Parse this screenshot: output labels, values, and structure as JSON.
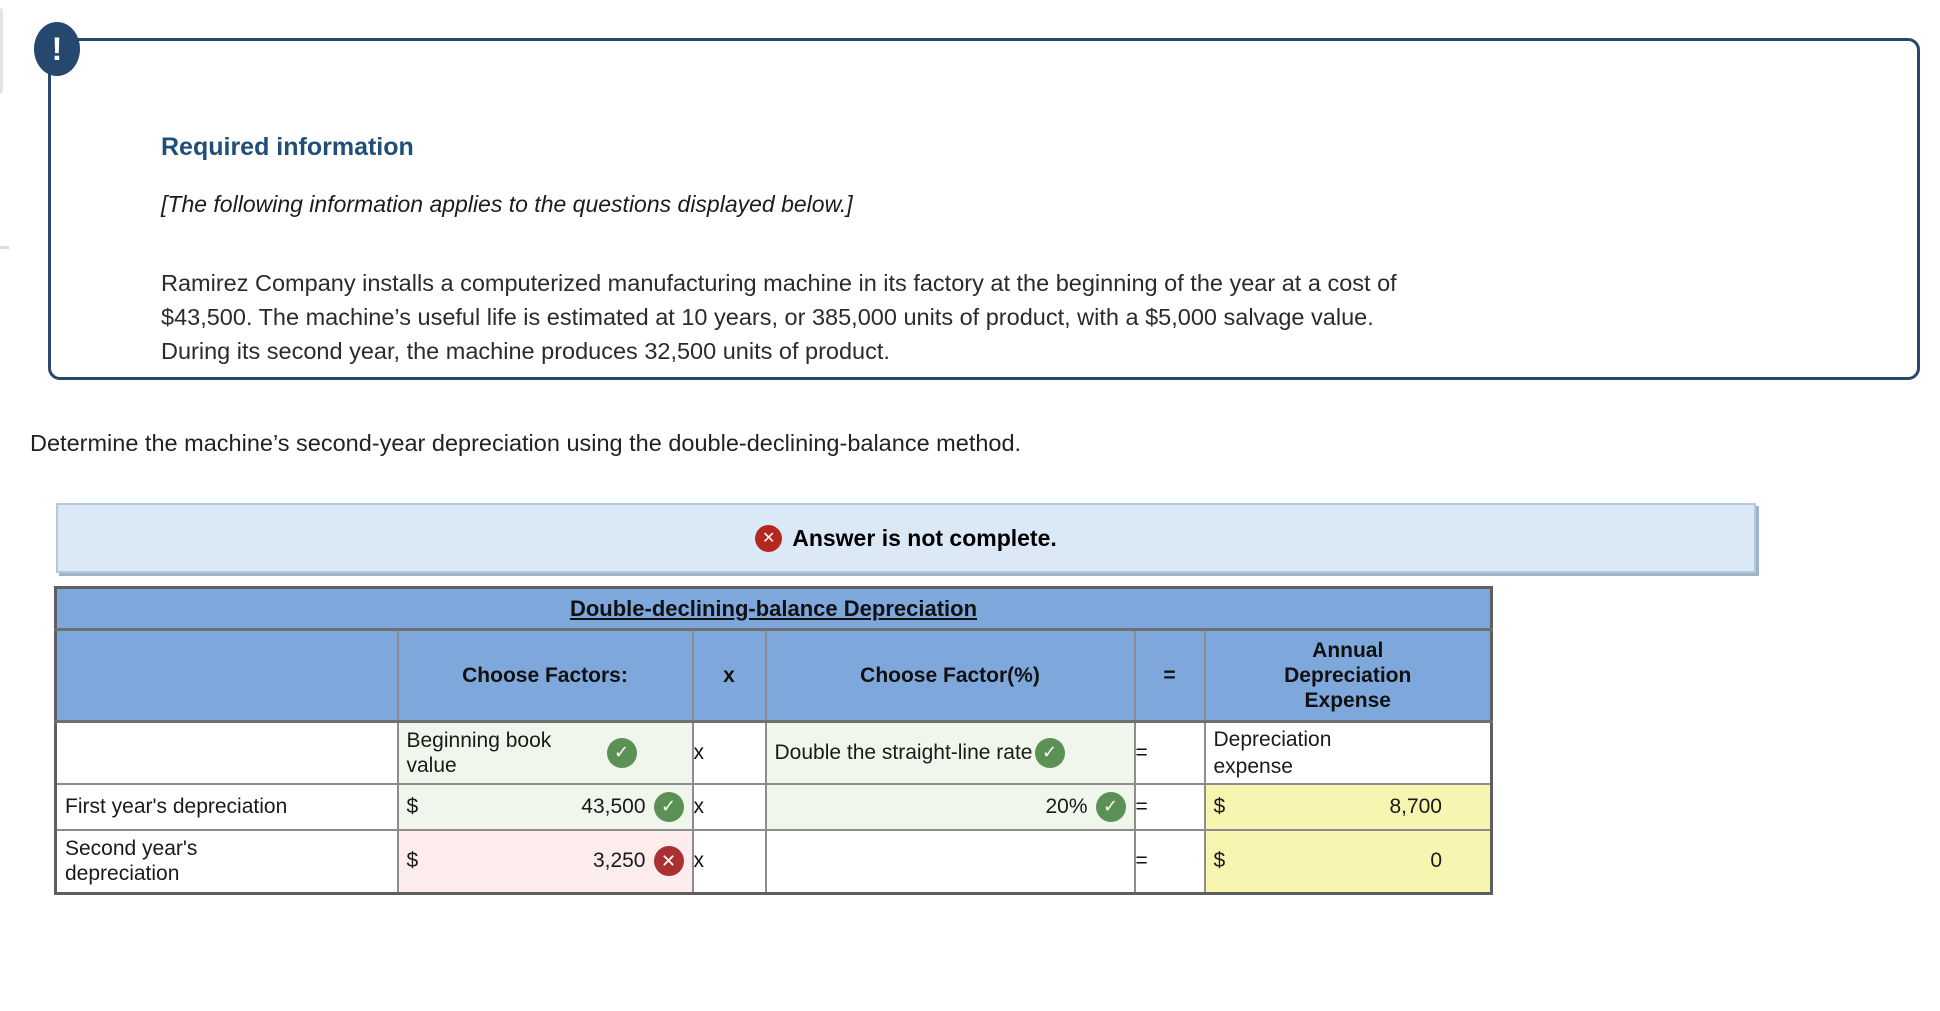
{
  "icons": {
    "exclamation": "!",
    "check": "✓",
    "cross": "✕"
  },
  "colors": {
    "navy_border": "#26486f",
    "heading_blue": "#1f4e79",
    "banner_bg": "#dbe9f7",
    "table_header_blue": "#7ea7db",
    "correct_green": "#5b9155",
    "incorrect_red": "#a93131",
    "banner_red": "#b5281e",
    "cell_correct_bg": "#f0f6ec",
    "cell_incorrect_bg": "#fcecec",
    "cell_computed_bg": "#f8f5b1"
  },
  "info_box": {
    "heading": "Required information",
    "subheading": "[The following information applies to the questions displayed below.]",
    "body_lines": [
      "Ramirez Company installs a computerized manufacturing machine in its factory at the beginning of the year at a cost of",
      "$43,500. The machine’s useful life is estimated at 10 years, or 385,000 units of product, with a $5,000 salvage value.",
      "During its second year, the machine produces 32,500 units of product."
    ]
  },
  "question": "Determine the machine’s second-year depreciation using the double-declining-balance method.",
  "status_banner": {
    "text": "Answer is not complete."
  },
  "table": {
    "title": "Double-declining-balance Depreciation",
    "header": [
      "",
      "Choose Factors:",
      "x",
      "Choose Factor(%)",
      "=",
      "Annual Depreciation Expense"
    ],
    "rows": [
      {
        "label": "",
        "factor": "Beginning book value",
        "factor_status": "correct",
        "times": "x",
        "rate": "Double the straight-line rate",
        "rate_status": "correct",
        "equals": "=",
        "annual": "Depreciation expense"
      },
      {
        "label": "First year's depreciation",
        "dollar": "$",
        "factor": "43,500",
        "factor_status": "correct",
        "times": "x",
        "rate": "20%",
        "rate_status": "correct",
        "equals": "=",
        "annual_dollar": "$",
        "annual": "8,700"
      },
      {
        "label": "Second year's depreciation",
        "dollar": "$",
        "factor": "3,250",
        "factor_status": "incorrect",
        "times": "x",
        "rate": "",
        "equals": "=",
        "annual_dollar": "$",
        "annual": "0"
      }
    ]
  }
}
